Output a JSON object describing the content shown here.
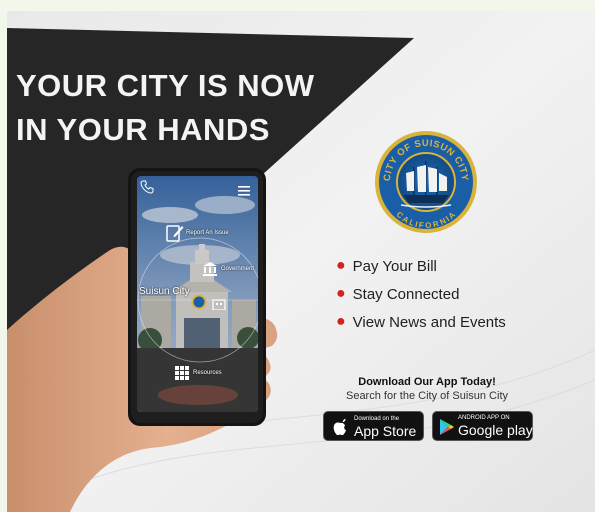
{
  "poster": {
    "headline_line1": "YOUR CITY IS NOW",
    "headline_line2": "IN YOUR HANDS",
    "features": [
      "Pay Your Bill",
      "Stay Connected",
      "View News and Events"
    ],
    "download_title": "Download Our App Today!",
    "download_subtitle": "Search for the City of Suisun City",
    "bullet_color": "#d6221f"
  },
  "seal": {
    "top_text": "CITY OF SUISUN CITY",
    "bottom_text": "CALIFORNIA"
  },
  "badges": {
    "app_store": {
      "small": "Download on the",
      "big": "App Store"
    },
    "google_play": {
      "small": "ANDROID APP ON",
      "big": "Google play"
    }
  },
  "phone_app": {
    "city_label": "Suisun City",
    "report_label": "Report An Issue",
    "government_label": "Government",
    "resources_label": "Resources",
    "icons": [
      "phone-icon",
      "menu-icon",
      "report-issue-icon",
      "government-icon",
      "resources-icon",
      "city-seal-icon"
    ]
  }
}
